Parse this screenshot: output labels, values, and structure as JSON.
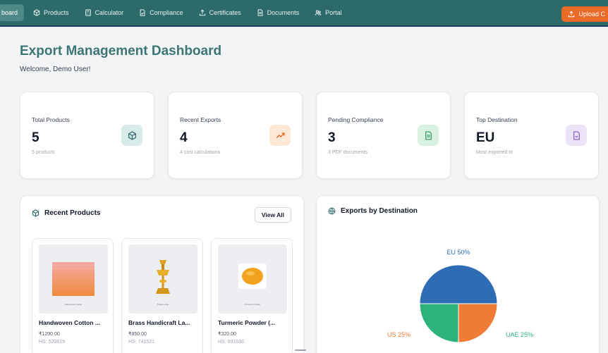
{
  "nav": {
    "items": [
      {
        "label": "board",
        "icon": "dashboard-icon",
        "active": true
      },
      {
        "label": "Products",
        "icon": "box-icon",
        "active": false
      },
      {
        "label": "Calculator",
        "icon": "calculator-icon",
        "active": false
      },
      {
        "label": "Compliance",
        "icon": "file-check-icon",
        "active": false
      },
      {
        "label": "Certificates",
        "icon": "upload-icon",
        "active": false
      },
      {
        "label": "Documents",
        "icon": "document-icon",
        "active": false
      },
      {
        "label": "Portal",
        "icon": "users-icon",
        "active": false
      }
    ],
    "upload_label": "Upload C"
  },
  "header": {
    "title": "Export Management Dashboard",
    "welcome": "Welcome, Demo User!"
  },
  "stats": [
    {
      "label": "Total Products",
      "value": "5",
      "sub": "5 products",
      "icon": "box-icon",
      "icon_bg": "#d7ebe8",
      "icon_color": "#2d6b6a"
    },
    {
      "label": "Recent Exports",
      "value": "4",
      "sub": "4 cost calculations",
      "icon": "trending-up-icon",
      "icon_bg": "#fde7d5",
      "icon_color": "#ea6a28"
    },
    {
      "label": "Pending Compliance",
      "value": "3",
      "sub": "3 PDF documents",
      "icon": "document-icon",
      "icon_bg": "#d9f1e1",
      "icon_color": "#2f9a5e"
    },
    {
      "label": "Top Destination",
      "value": "EU",
      "sub": "Most exported to",
      "icon": "file-icon",
      "icon_bg": "#ebe3f7",
      "icon_color": "#8a5cc9"
    }
  ],
  "recent_products": {
    "title": "Recent Products",
    "view_all": "View All",
    "items": [
      {
        "name": "Handwoven Cotton ...",
        "price": "₹1200.00",
        "hs": "HS: 520819",
        "thumb_caption": "Handwoven Saree"
      },
      {
        "name": "Brass Handicraft La...",
        "price": "₹850.00",
        "hs": "HS: 741521",
        "thumb_caption": "Brass Lamp"
      },
      {
        "name": "Turmeric Powder (...",
        "price": "₹320.00",
        "hs": "HS: 091030",
        "thumb_caption": "Turmeric Powder"
      }
    ]
  },
  "exports_chart": {
    "title": "Exports by Destination"
  },
  "chart_data": {
    "type": "pie",
    "title": "Exports by Destination",
    "categories": [
      "EU",
      "US",
      "UAE"
    ],
    "values": [
      50,
      25,
      25
    ],
    "labels": [
      "EU 50%",
      "US 25%",
      "UAE 25%"
    ],
    "colors": [
      "#2f6cb6",
      "#ef7b35",
      "#2cb27a"
    ]
  },
  "colors": {
    "nav_bg": "#2d6b6a",
    "accent_orange": "#ea6a28",
    "title_teal": "#3d7573"
  }
}
